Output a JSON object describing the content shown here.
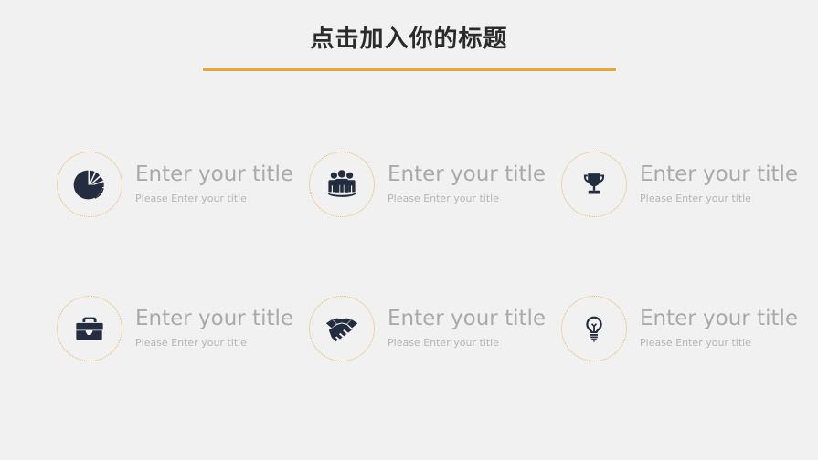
{
  "slide": {
    "title": "点击加入你的标题",
    "colors": {
      "background": "#f1f1f1",
      "accent": "#e3a740",
      "ring": "#e5b560",
      "icon": "#242d40",
      "title_text": "#2b2b2b",
      "item_title_text": "#a9a9a9",
      "item_sub_text": "#b5b5b5"
    }
  },
  "features": [
    {
      "icon": "pie-chart-icon",
      "title": "Enter your title",
      "subtitle": "Please Enter your title"
    },
    {
      "icon": "team-group-icon",
      "title": "Enter your title",
      "subtitle": "Please Enter your title"
    },
    {
      "icon": "trophy-icon",
      "title": "Enter your title",
      "subtitle": "Please Enter your title"
    },
    {
      "icon": "briefcase-icon",
      "title": "Enter your title",
      "subtitle": "Please Enter your title"
    },
    {
      "icon": "handshake-icon",
      "title": "Enter your title",
      "subtitle": "Please Enter your title"
    },
    {
      "icon": "lightbulb-icon",
      "title": "Enter your title",
      "subtitle": "Please Enter your title"
    }
  ]
}
